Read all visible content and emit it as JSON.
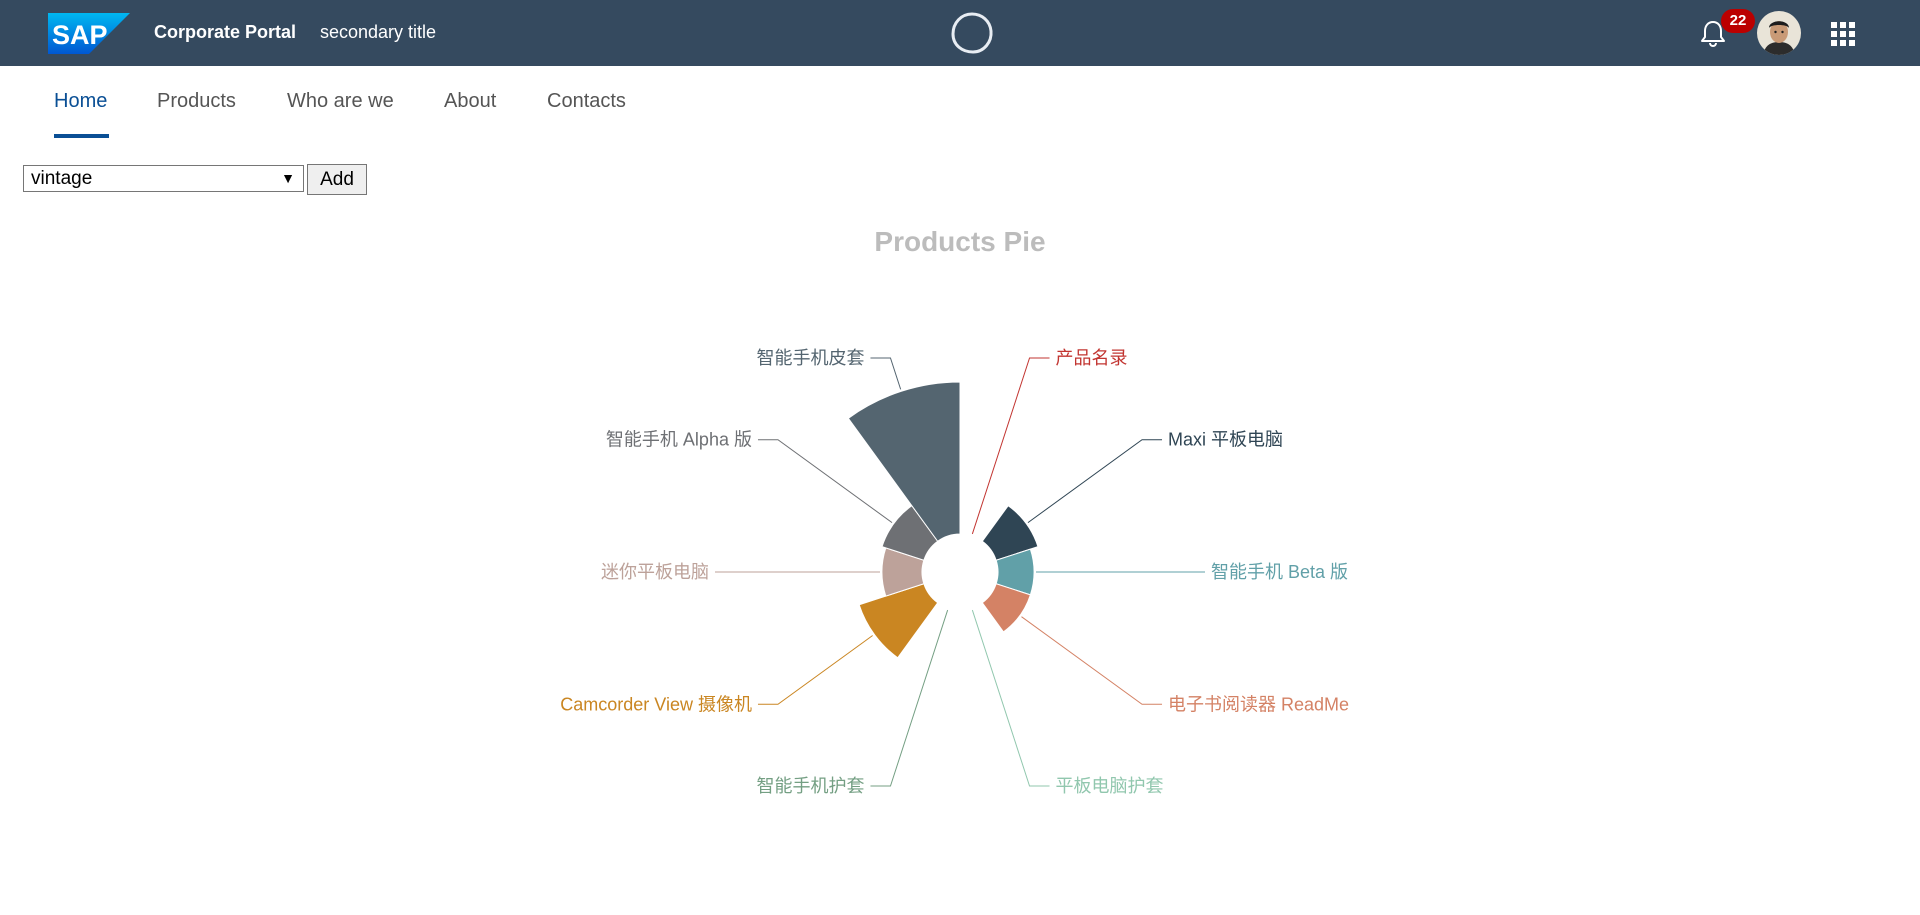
{
  "shellbar": {
    "logo_text": "SAP",
    "product_title": "Corporate Portal",
    "secondary_title": "secondary title",
    "notification_count": "22",
    "icons": {
      "co_pilot": "co-pilot-icon",
      "notifications": "bell-icon",
      "avatar": "avatar",
      "product_switch": "grid-icon"
    },
    "colors": {
      "background": "#354a5f",
      "badge": "#bb0000"
    }
  },
  "tabs": [
    {
      "label": "Home",
      "active": true
    },
    {
      "label": "Products",
      "active": false
    },
    {
      "label": "Who are we",
      "active": false
    },
    {
      "label": "About",
      "active": false
    },
    {
      "label": "Contacts",
      "active": false
    }
  ],
  "toolbar": {
    "theme_select_value": "vintage",
    "add_label": "Add"
  },
  "chart_data": {
    "type": "pie",
    "variant": "rose",
    "title": "Products Pie",
    "title_color": "#bcbcbc",
    "slices": [
      {
        "name": "产品名录",
        "value": 0,
        "color": "#c23531"
      },
      {
        "name": "Maxi 平板电脑",
        "value": 55,
        "color": "#2f4554"
      },
      {
        "name": "智能手机 Beta 版",
        "value": 45,
        "color": "#61a0a8"
      },
      {
        "name": "电子书阅读器 ReadMe",
        "value": 45,
        "color": "#d48265"
      },
      {
        "name": "平板电脑护套",
        "value": 0,
        "color": "#91c7ae"
      },
      {
        "name": "智能手机护套",
        "value": 0,
        "color": "#749f83"
      },
      {
        "name": "Camcorder View 摄像机",
        "value": 85,
        "color": "#ca8622"
      },
      {
        "name": "迷你平板电脑",
        "value": 50,
        "color": "#bda29a"
      },
      {
        "name": "智能手机 Alpha 版",
        "value": 55,
        "color": "#6e7074"
      },
      {
        "name": "智能手机皮套",
        "value": 190,
        "color": "#546570"
      }
    ]
  }
}
